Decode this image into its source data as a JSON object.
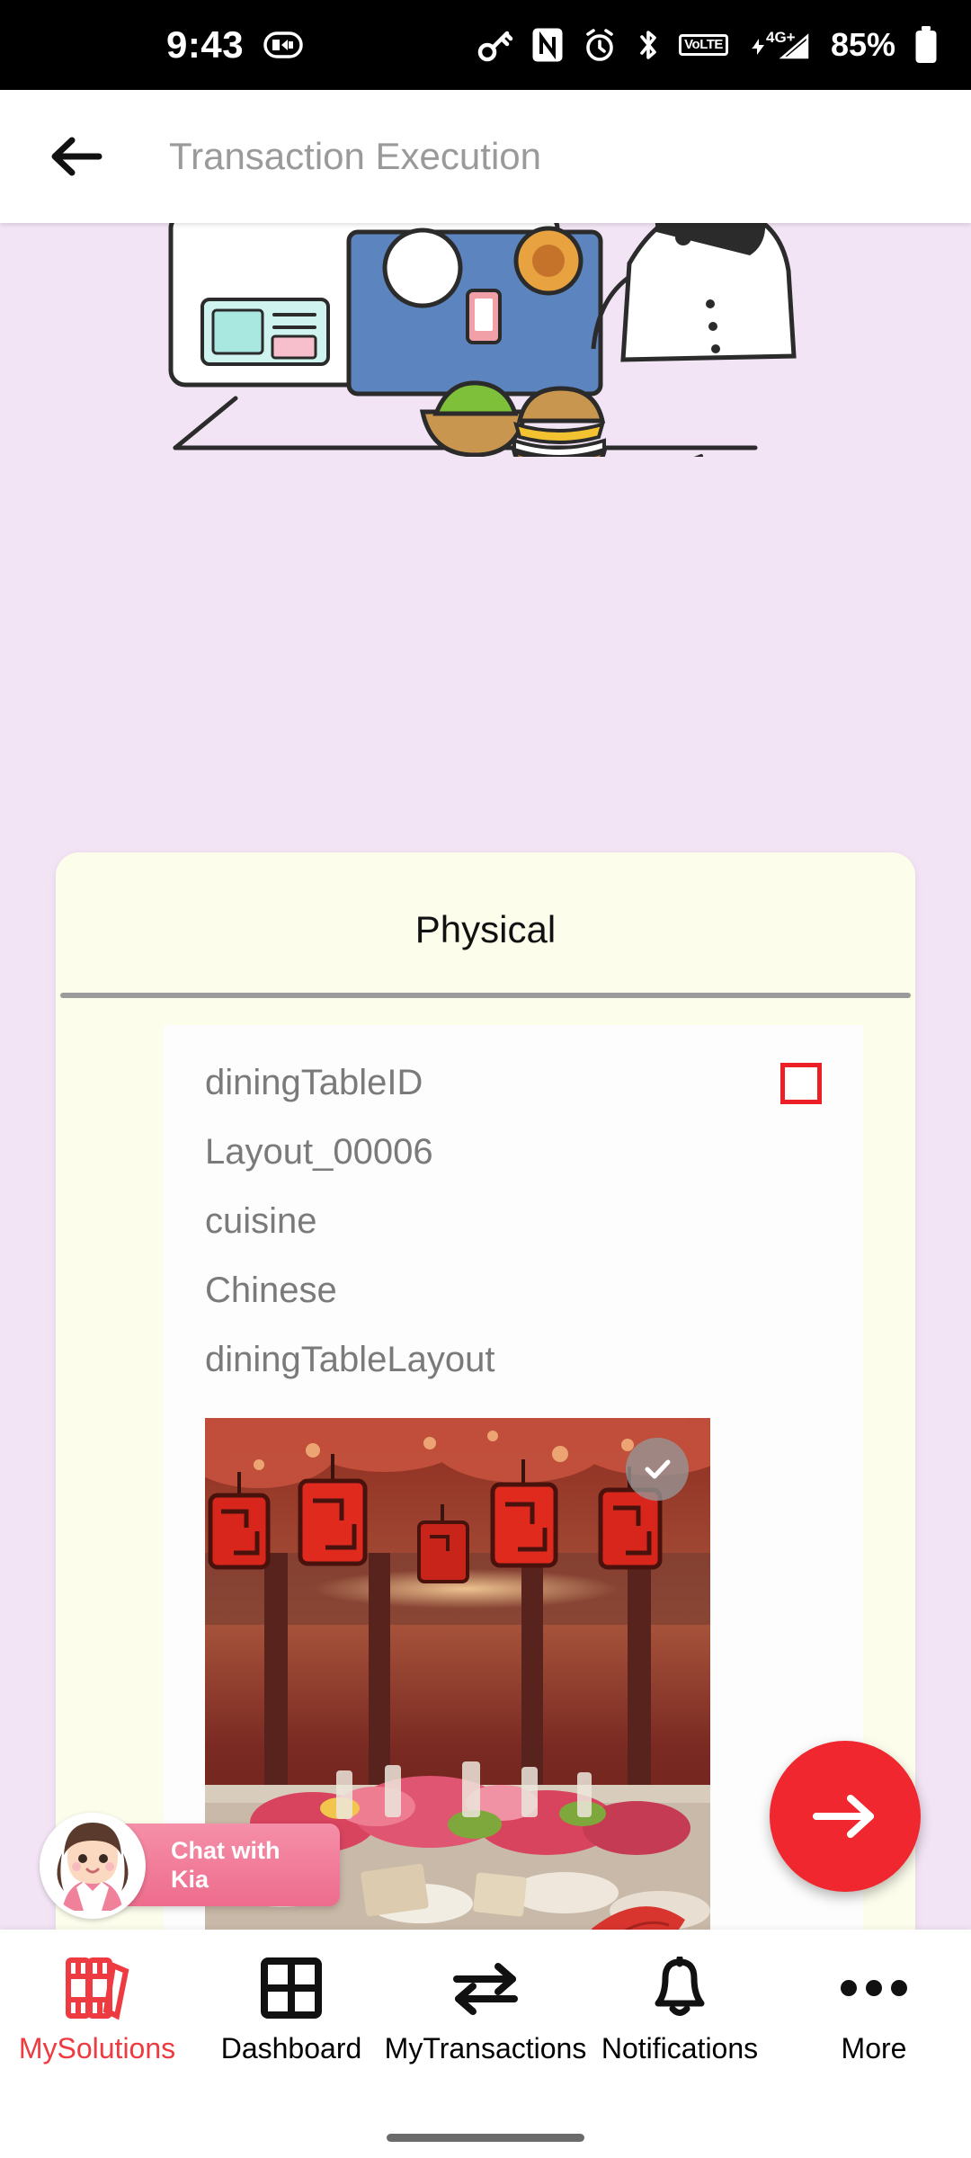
{
  "status_bar": {
    "time": "9:43",
    "battery_percent": "85%",
    "volte_label": "VoLTE",
    "network_label": "4G+",
    "icons": [
      "cast-icon",
      "key-icon",
      "nfc-icon",
      "alarm-icon",
      "bluetooth-icon",
      "volte-icon",
      "signal-icon",
      "battery-icon"
    ]
  },
  "app_bar": {
    "back_icon": "arrow-left-icon",
    "title": "Transaction Execution"
  },
  "card": {
    "title": "Physical",
    "fields": [
      {
        "label": "diningTableID",
        "has_checkbox": true
      },
      {
        "label": "Layout_00006",
        "has_checkbox": false
      },
      {
        "label": "cuisine",
        "has_checkbox": false
      },
      {
        "label": "Chinese",
        "has_checkbox": false
      },
      {
        "label": "diningTableLayout",
        "has_checkbox": false
      }
    ],
    "photo": {
      "name": "chinese-restaurant-lanterns-photo",
      "selected": true,
      "badge_icon": "check-icon"
    }
  },
  "chat_widget": {
    "line1": "Chat with",
    "line2": "Kia",
    "avatar_icon": "assistant-avatar"
  },
  "fab": {
    "icon": "arrow-right-icon",
    "color": "#F0272E"
  },
  "bottom_nav": {
    "items": [
      {
        "label": "MySolutions",
        "icon": "books-icon",
        "active": true
      },
      {
        "label": "Dashboard",
        "icon": "grid-icon",
        "active": false
      },
      {
        "label": "MyTransactions",
        "icon": "swap-arrows-icon",
        "active": false
      },
      {
        "label": "Notifications",
        "icon": "bell-icon",
        "active": false
      },
      {
        "label": "More",
        "icon": "ellipsis-icon",
        "active": false
      }
    ]
  },
  "colors": {
    "background": "#F2E4F4",
    "card": "#FDFDEC",
    "accent_red": "#EE3A41",
    "fab_red": "#F0272E"
  }
}
